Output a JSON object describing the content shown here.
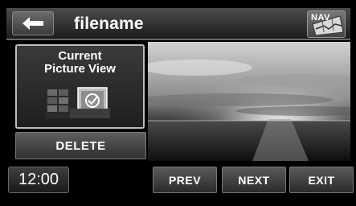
{
  "header": {
    "back_icon": "left-arrow-icon",
    "title": "filename",
    "nav_label": "NAV",
    "nav_icon": "map-icon"
  },
  "left_panel": {
    "current_picture_view_line1": "Current",
    "current_picture_view_line2": "Picture View",
    "thumbnail_icon": "picture-view-icon",
    "delete_label": "DELETE"
  },
  "main": {
    "image_description_icon": "photo-preview"
  },
  "bottom_bar": {
    "time": "12:00",
    "prev_label": "PREV",
    "next_label": "NEXT",
    "exit_label": "EXIT"
  },
  "colors": {
    "background": "#000000",
    "button_top": "#5e5e5e",
    "button_bottom": "#2f2f2f",
    "text": "#ffffff",
    "border_highlight": "#bdbdbd"
  }
}
